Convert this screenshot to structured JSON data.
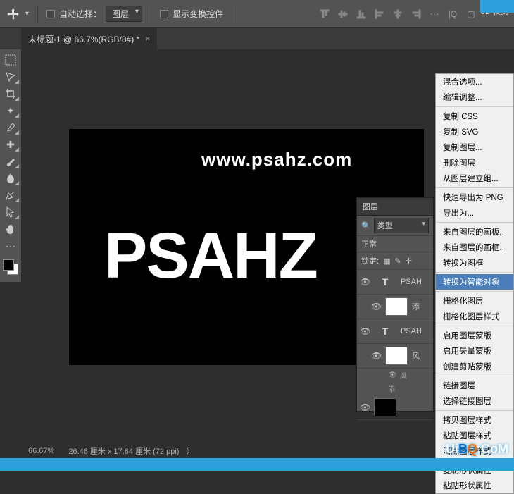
{
  "options": {
    "auto_select": "自动选择：",
    "auto_select_target": "图层",
    "show_transform": "显示变换控件",
    "mode3d": "3D 模式"
  },
  "tabs": {
    "doc": "未标题-1 @ 66.7%(RGB/8#) *"
  },
  "canvas": {
    "watermark": "www.psahz.com",
    "text": "PSAHZ"
  },
  "status": {
    "zoom": "66.67%",
    "doc_size": "26.46 厘米 x 17.64 厘米 (72 ppi)"
  },
  "layers": {
    "title": "图层",
    "type_label": "类型",
    "blend": "正常",
    "lock_label": "锁定:",
    "items": [
      {
        "name": "PSAH",
        "kind": "T"
      },
      {
        "name": "添",
        "kind": "white",
        "fx": true,
        "child": true
      },
      {
        "name": "PSAH",
        "kind": "T"
      },
      {
        "name": "风",
        "kind": "white",
        "fx": true,
        "child": true
      },
      {
        "name": "风",
        "kind": "fx-only",
        "child": true
      },
      {
        "name": "添",
        "kind": "fx-only",
        "child": true
      }
    ],
    "fx_label": "风"
  },
  "menu": {
    "groups": [
      [
        "混合选项...",
        "编辑调整..."
      ],
      [
        "复制 CSS",
        "复制 SVG",
        "复制图层...",
        "删除图层",
        "从图层建立组..."
      ],
      [
        "快速导出为 PNG",
        "导出为..."
      ],
      [
        "来自图层的画板..",
        "来自图层的画框..",
        "转换为图框"
      ],
      [
        "转换为智能对象"
      ],
      [
        "栅格化图层",
        "栅格化图层样式"
      ],
      [
        "启用图层蒙版",
        "启用矢量蒙版",
        "创建剪贴蒙版"
      ],
      [
        "链接图层",
        "选择链接图层"
      ],
      [
        "拷贝图层样式",
        "粘贴图层样式",
        "清除图层样式"
      ],
      [
        "复制形状属性",
        "粘贴形状属性"
      ]
    ],
    "highlighted": "转换为智能对象"
  },
  "uibq": {
    "text": "UiBQ.CoM"
  }
}
